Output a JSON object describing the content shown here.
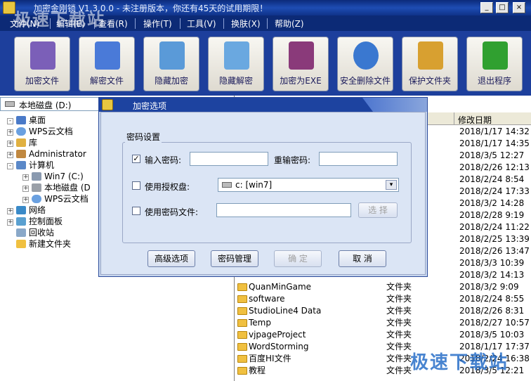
{
  "window": {
    "title": "加密金刚锁 V1.3.0.0 - 未注册版本，你还有45天的试用期限！"
  },
  "window_buttons": [
    "_",
    "□",
    "×"
  ],
  "menu": [
    "文件(N)",
    "编辑(E)",
    "查看(R)",
    "操作(T)",
    "工具(V)",
    "换肤(X)",
    "帮助(Z)"
  ],
  "toolbar": [
    {
      "label": "加密文件",
      "icon": "encrypt-book-icon",
      "color": "#7b5fb8"
    },
    {
      "label": "解密文件",
      "icon": "decrypt-book-icon",
      "color": "#4a7ad8"
    },
    {
      "label": "隐藏加密",
      "icon": "hide-drive-lock-icon",
      "color": "#5a9ad8"
    },
    {
      "label": "隐藏解密",
      "icon": "hide-drive-key-icon",
      "color": "#6aa8e0"
    },
    {
      "label": "加密为EXE",
      "icon": "exe-archive-icon",
      "color": "#8a3a7a"
    },
    {
      "label": "安全删除文件",
      "icon": "safe-delete-icon",
      "color": "#3a78d0"
    },
    {
      "label": "保护文件夹",
      "icon": "protect-folder-icon",
      "color": "#d8a030"
    },
    {
      "label": "退出程序",
      "icon": "exit-arrow-icon",
      "color": "#30a030"
    }
  ],
  "drive_selector": {
    "value": "本地磁盘 (D:)"
  },
  "tree": [
    {
      "label": "桌面",
      "level": 0,
      "expander": "-",
      "icon": "desktop-icon",
      "color": "#4a7ac8"
    },
    {
      "label": "WPS云文档",
      "level": 1,
      "expander": "+",
      "icon": "cloud-icon",
      "color": "#6aa0e0"
    },
    {
      "label": "库",
      "level": 1,
      "expander": "+",
      "icon": "library-icon",
      "color": "#e0b040"
    },
    {
      "label": "Administrator",
      "level": 1,
      "expander": "+",
      "icon": "user-icon",
      "color": "#c08840"
    },
    {
      "label": "计算机",
      "level": 1,
      "expander": "-",
      "icon": "computer-icon",
      "color": "#5a88c8"
    },
    {
      "label": "Win7 (C:)",
      "level": 2,
      "expander": "+",
      "icon": "system-drive-icon",
      "color": "#8a9ab0"
    },
    {
      "label": "本地磁盘 (D",
      "level": 2,
      "expander": "+",
      "icon": "drive-icon",
      "color": "#9aa0a8"
    },
    {
      "label": "WPS云文档",
      "level": 2,
      "expander": "+",
      "icon": "cloud-icon",
      "color": "#6aa0e0"
    },
    {
      "label": "网络",
      "level": 1,
      "expander": "+",
      "icon": "network-icon",
      "color": "#3a8ac8"
    },
    {
      "label": "控制面板",
      "level": 1,
      "expander": "+",
      "icon": "control-panel-icon",
      "color": "#5aa0d0"
    },
    {
      "label": "回收站",
      "level": 1,
      "expander": "",
      "icon": "recycle-bin-icon",
      "color": "#8aa8c8"
    },
    {
      "label": "新建文件夹",
      "level": 1,
      "expander": "",
      "icon": "folder-icon",
      "color": "#f0c040"
    }
  ],
  "file_header": {
    "date": "修改日期"
  },
  "files": [
    {
      "name": "",
      "type": "",
      "date": "2018/1/17 14:32"
    },
    {
      "name": "",
      "type": "",
      "date": "2018/1/17 14:35"
    },
    {
      "name": "",
      "type": "",
      "date": "2018/3/5 12:27"
    },
    {
      "name": "",
      "type": "",
      "date": "2018/2/26 12:13"
    },
    {
      "name": "",
      "type": "",
      "date": "2018/2/24 8:54"
    },
    {
      "name": "",
      "type": "",
      "date": "2018/2/24 17:33"
    },
    {
      "name": "",
      "type": "",
      "date": "2018/3/2 14:28"
    },
    {
      "name": "",
      "type": "",
      "date": "2018/2/28 9:19"
    },
    {
      "name": "",
      "type": "",
      "date": "2018/2/24 11:22"
    },
    {
      "name": "",
      "type": "",
      "date": "2018/2/25 13:39"
    },
    {
      "name": "",
      "type": "",
      "date": "2018/2/26 13:47"
    },
    {
      "name": "",
      "type": "",
      "date": "2018/3/3 10:39"
    },
    {
      "name": "",
      "type": "",
      "date": "2018/3/2 14:13"
    },
    {
      "name": "QuanMinGame",
      "type": "文件夹",
      "date": "2018/3/2 9:09"
    },
    {
      "name": "software",
      "type": "文件夹",
      "date": "2018/2/24 8:55"
    },
    {
      "name": "StudioLine4 Data",
      "type": "文件夹",
      "date": "2018/2/26 8:31"
    },
    {
      "name": "Temp",
      "type": "文件夹",
      "date": "2018/2/27 10:57"
    },
    {
      "name": "vjpageProject",
      "type": "文件夹",
      "date": "2018/3/5 10:03"
    },
    {
      "name": "WordStorming",
      "type": "文件夹",
      "date": "2018/1/17 17:37"
    },
    {
      "name": "百度HI文件",
      "type": "文件夹",
      "date": "2018/2/24 16:38"
    },
    {
      "name": "教程",
      "type": "文件夹",
      "date": "2018/3/5 12:21"
    }
  ],
  "dialog": {
    "title": "加密选项",
    "group": "密码设置",
    "password_label": "输入密码:",
    "repeat_label": "重输密码:",
    "password_value": "",
    "repeat_value": "",
    "password_checked": "✓",
    "auth_disk_label": "使用授权盘:",
    "auth_disk_value": "c: [win7]",
    "key_file_label": "使用密码文件:",
    "key_file_value": "",
    "choose_button": "选 择",
    "buttons": {
      "advanced": "高级选项",
      "manage": "密码管理",
      "ok": "确  定",
      "cancel": "取  消"
    }
  },
  "watermarks": {
    "top": "极速下载站",
    "bottom": "极速下载站"
  }
}
